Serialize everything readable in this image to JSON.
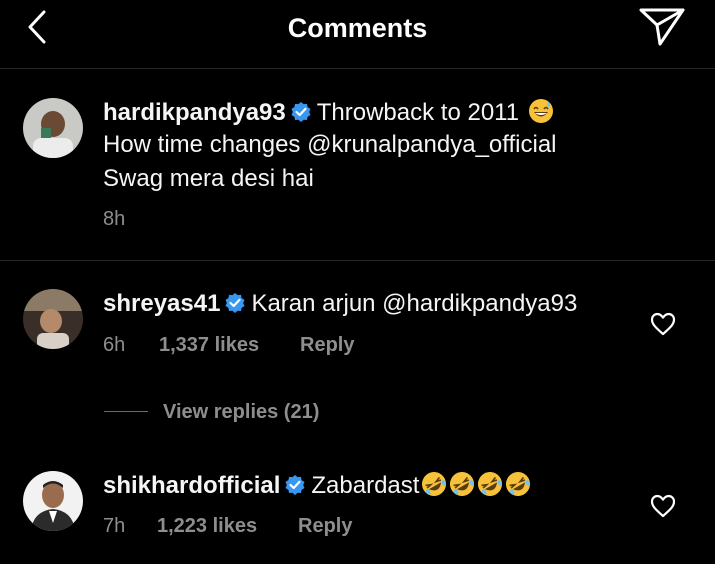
{
  "header": {
    "title": "Comments"
  },
  "caption": {
    "username": "hardikpandya93",
    "text_line1": "Throwback to 2011",
    "text_line2_prefix": "How time changes ",
    "mention": "@krunalpandya_official",
    "text_line3": "Swag mera desi hai",
    "time": "8h"
  },
  "comments": [
    {
      "username": "shreyas41",
      "text": "Karan arjun @hardikpandya93",
      "time": "6h",
      "likes": "1,337 likes",
      "reply": "Reply",
      "view_replies": "View replies (21)"
    },
    {
      "username": "shikhardofficial",
      "text": "Zabardast",
      "time": "7h",
      "likes": "1,223 likes",
      "reply": "Reply"
    }
  ],
  "icons": {
    "back": "chevron-left-icon",
    "send": "paper-plane-icon",
    "verified": "verified-badge-icon",
    "heart": "heart-outline-icon",
    "emoji_sweat_smile": "grinning-sweat-emoji",
    "emoji_rofl": "rolling-on-floor-laughing-emoji"
  },
  "colors": {
    "background": "#000000",
    "verified": "#3897f0",
    "secondary_text": "#8e8e8e"
  }
}
